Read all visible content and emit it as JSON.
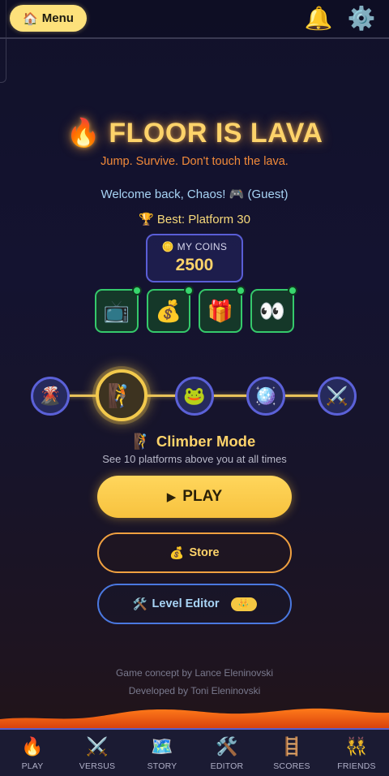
{
  "topbar": {
    "menu_icon": "🏠",
    "menu_label": "Menu",
    "bell_icon": "🔔",
    "settings_icon": "⚙️"
  },
  "header": {
    "title_icon": "🔥",
    "title": "FLOOR IS LAVA",
    "subtitle": "Jump. Survive. Don't touch the lava."
  },
  "player": {
    "welcome": "Welcome back, Chaos! 🎮 (Guest)",
    "best": "🏆 Best: Platform 30",
    "coins_label": "🪙 MY COINS",
    "coins": "2500"
  },
  "rewards": [
    {
      "icon": "📺",
      "name": "tv-icon"
    },
    {
      "icon": "💰",
      "name": "money-bag-icon"
    },
    {
      "icon": "🎁",
      "name": "gift-icon"
    },
    {
      "icon": "👀",
      "name": "eyes-icon"
    }
  ],
  "modes": [
    {
      "icon": "🌋",
      "name": "volcano-icon",
      "active": false
    },
    {
      "icon": "🧗",
      "name": "climber-icon",
      "active": true
    },
    {
      "icon": "🐸",
      "name": "frog-icon",
      "active": false
    },
    {
      "icon": "🪩",
      "name": "disco-ball-icon",
      "active": false
    },
    {
      "icon": "⚔️",
      "name": "crossed-swords-icon",
      "active": false
    }
  ],
  "selected_mode": {
    "icon": "🧗",
    "name": "Climber Mode",
    "description": "See 10 platforms above you at all times"
  },
  "actions": {
    "play_icon": "▶",
    "play_label": "PLAY",
    "store_icon": "💰",
    "store_label": "Store",
    "editor_icon": "🛠️",
    "editor_label": "Level Editor",
    "editor_badge": "👑"
  },
  "credits": {
    "concept": "Game concept by Lance Eleninovski",
    "developer": "Developed by Toni Eleninovski"
  },
  "colors": {
    "accent_gold": "#fdd36a",
    "lava_orange": "#f28a3a",
    "reward_green": "#35c96b",
    "mode_blue": "#5b61d8"
  },
  "nav": [
    {
      "icon": "🔥",
      "label": "PLAY",
      "name": "fire-icon"
    },
    {
      "icon": "⚔️",
      "label": "VERSUS",
      "name": "crossed-swords-icon"
    },
    {
      "icon": "🗺️",
      "label": "STORY",
      "name": "map-icon"
    },
    {
      "icon": "🛠️",
      "label": "EDITOR",
      "name": "tools-icon"
    },
    {
      "icon": "🪜",
      "label": "SCORES",
      "name": "ladder-icon"
    },
    {
      "icon": "👯",
      "label": "FRIENDS",
      "name": "friends-icon"
    }
  ]
}
